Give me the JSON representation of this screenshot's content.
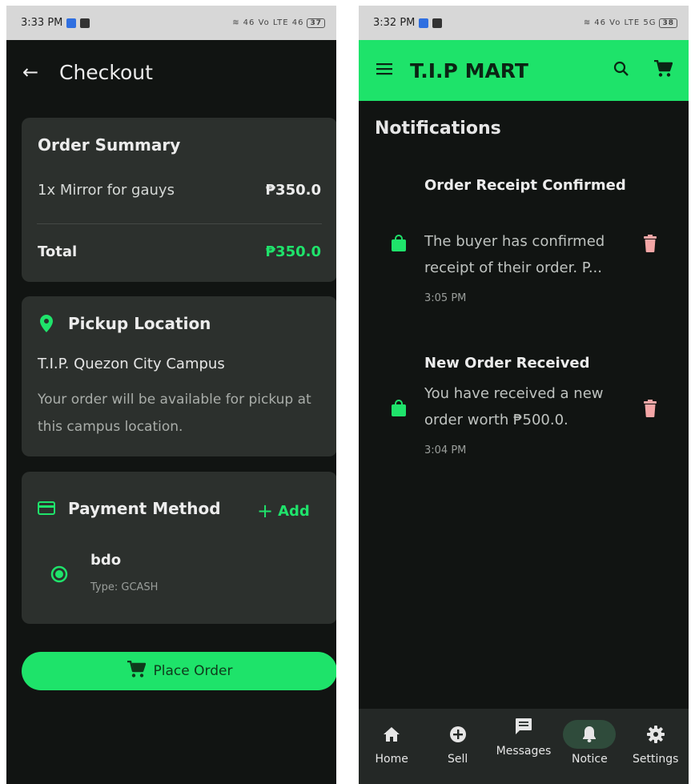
{
  "left": {
    "status": {
      "time": "3:33 PM",
      "battery": "37",
      "signal": "46 Vo LTE 46"
    },
    "header": {
      "title": "Checkout",
      "back_icon": "arrow-left-icon"
    },
    "order_summary": {
      "title": "Order Summary",
      "item": "1x Mirror for gauys",
      "item_price": "₱350.0",
      "total_label": "Total",
      "total_value": "₱350.0"
    },
    "pickup": {
      "title": "Pickup Location",
      "campus": "T.I.P. Quezon City Campus",
      "note": "Your order will be available for pickup at this campus location."
    },
    "payment": {
      "title": "Payment Method",
      "add_label": "Add",
      "method_name": "bdo",
      "method_type": "Type: GCASH"
    },
    "place_order_label": "Place Order"
  },
  "right": {
    "status": {
      "time": "3:32 PM",
      "battery": "38",
      "signal": "46 Vo LTE 5G"
    },
    "appbar": {
      "brand": "T.I.P MART"
    },
    "page_title": "Notifications",
    "notifications": [
      {
        "title": "Order Receipt Confirmed",
        "message": "The buyer has confirmed receipt of their order. P...",
        "time": "3:05 PM"
      },
      {
        "title": "New Order Received",
        "message": "You have received a new order worth ₱500.0.",
        "time": "3:04 PM"
      }
    ],
    "nav": [
      {
        "label": "Home",
        "icon": "home-icon"
      },
      {
        "label": "Sell",
        "icon": "plus-circle-icon"
      },
      {
        "label": "Messages",
        "icon": "message-icon"
      },
      {
        "label": "Notice",
        "icon": "bell-icon",
        "active": true
      },
      {
        "label": "Settings",
        "icon": "gear-icon"
      }
    ]
  },
  "colors": {
    "accent": "#1ee36a",
    "background": "#111412",
    "card": "#2c302d",
    "trash": "#f4a6a6"
  }
}
